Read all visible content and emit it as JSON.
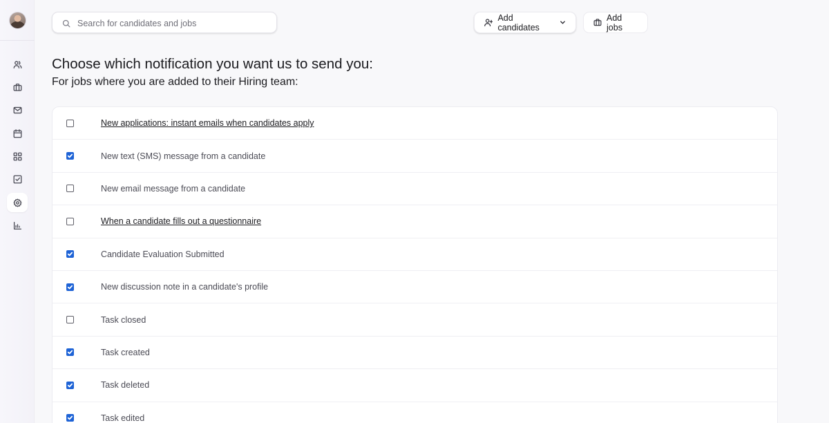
{
  "sidebar": {
    "avatar_alt": "",
    "items": [
      {
        "name": "candidates-icon",
        "active": false
      },
      {
        "name": "jobs-icon",
        "active": false
      },
      {
        "name": "mail-icon",
        "active": false
      },
      {
        "name": "calendar-icon",
        "active": false
      },
      {
        "name": "dashboard-icon",
        "active": false
      },
      {
        "name": "tasks-icon",
        "active": false
      },
      {
        "name": "settings-icon",
        "active": true
      },
      {
        "name": "reports-icon",
        "active": false
      }
    ]
  },
  "header": {
    "search_placeholder": "Search for candidates and jobs",
    "add_candidates_label": "Add candidates",
    "add_jobs_label": "Add jobs"
  },
  "main": {
    "title": "Choose which notification you want us to send you:",
    "subtitle": "For jobs where you are added to their Hiring team:",
    "notifications": [
      {
        "label": "New applications: instant emails when candidates apply",
        "checked": false,
        "link": true
      },
      {
        "label": "New text (SMS) message from a candidate",
        "checked": true,
        "link": false
      },
      {
        "label": "New email message from a candidate",
        "checked": false,
        "link": false
      },
      {
        "label": "When a candidate fills out a questionnaire",
        "checked": false,
        "link": true
      },
      {
        "label": "Candidate Evaluation Submitted",
        "checked": true,
        "link": false
      },
      {
        "label": "New discussion note in a candidate's profile",
        "checked": true,
        "link": false
      },
      {
        "label": "Task closed",
        "checked": false,
        "link": false
      },
      {
        "label": "Task created",
        "checked": true,
        "link": false
      },
      {
        "label": "Task deleted",
        "checked": true,
        "link": false
      },
      {
        "label": "Task edited",
        "checked": true,
        "link": false
      }
    ]
  },
  "colors": {
    "accent": "#1e63d6",
    "background": "#f8f8fa"
  }
}
